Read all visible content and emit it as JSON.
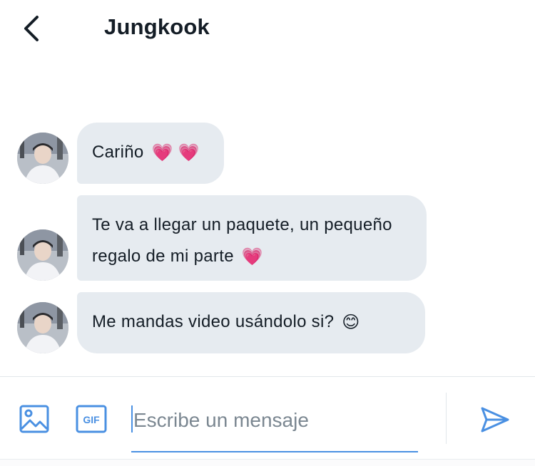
{
  "header": {
    "title": "Jungkook",
    "back_icon": "chevron-left-icon"
  },
  "messages": [
    {
      "text": "Cariño",
      "emoji": "💗 💗"
    },
    {
      "text": "Te va a llegar un paquete, un pequeño regalo de mi parte",
      "emoji": "💗"
    },
    {
      "text": "Me mandas video usándolo si?",
      "emoji": "😊"
    }
  ],
  "composer": {
    "media_icon": "image-icon",
    "gif_icon": "gif-icon",
    "gif_label": "GIF",
    "placeholder": "Escribe un mensaje",
    "send_icon": "send-icon"
  },
  "colors": {
    "accent": "#4a90e2",
    "bubble": "#e6ebf0",
    "text": "#141d26",
    "placeholder": "#7b8791"
  }
}
